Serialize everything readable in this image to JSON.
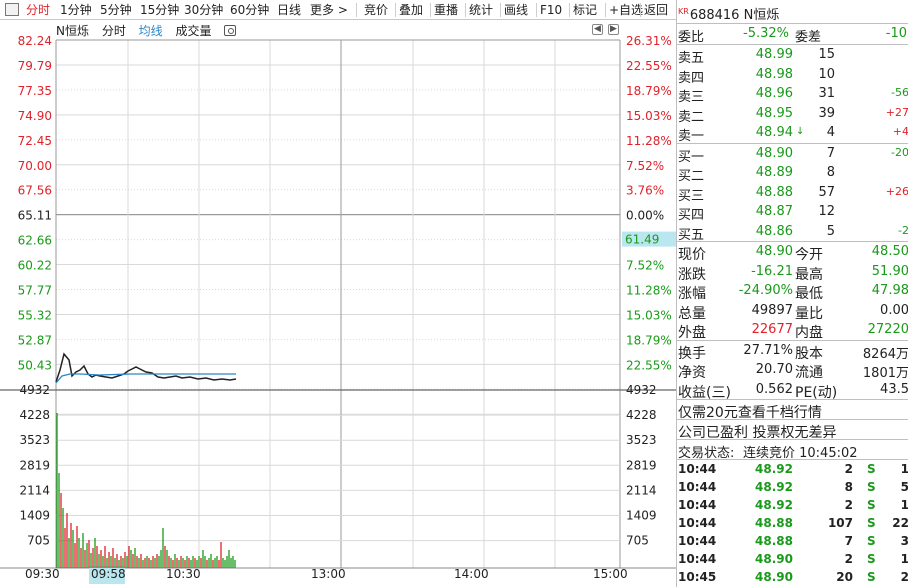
{
  "toolbar": {
    "tabs": [
      "分时",
      "1分钟",
      "5分钟",
      "15分钟",
      "30分钟",
      "60分钟",
      "日线",
      "更多 >"
    ],
    "actions": [
      "竞价",
      "叠加",
      "重播",
      "统计",
      "画线",
      "F10",
      "标记",
      "+自选",
      "返回"
    ]
  },
  "chart": {
    "header": {
      "name": "N恒烁",
      "mode": "分时",
      "avg": "均线",
      "vol": "成交量"
    },
    "price_labels": [
      "82.24",
      "79.79",
      "77.35",
      "74.90",
      "72.45",
      "70.00",
      "67.56",
      "65.11",
      "62.66",
      "60.22",
      "57.77",
      "55.32",
      "52.87",
      "50.43"
    ],
    "pct_labels": [
      "26.31%",
      "22.55%",
      "18.79%",
      "15.03%",
      "11.28%",
      "7.52%",
      "3.76%",
      "0.00%",
      "7.52%",
      "11.28%",
      "15.03%",
      "18.79%",
      "22.55%"
    ],
    "current_marker": "61.49",
    "vol_left_labels": [
      "4932",
      "4228",
      "3523",
      "2819",
      "2114",
      "1409",
      "705"
    ],
    "vol_right_labels": [
      "4932",
      "4228",
      "3523",
      "2819",
      "2114",
      "1409",
      "705"
    ],
    "time_labels": [
      "09:30",
      "09:58",
      "10:30",
      "13:00",
      "14:00",
      "15:00"
    ],
    "colors": {
      "up": "#e0222a",
      "down": "#1a9a1a",
      "price_line": "#222222",
      "avg_line": "#2a86c8",
      "grid": "#d9d9d9",
      "highlight": "#b9e6ef"
    }
  },
  "quote": {
    "market_tag": "KR",
    "code": "688416",
    "name": "N恒烁",
    "weibi_label": "委比",
    "weibi": "-5.32%",
    "weicha_label": "委差",
    "weicha": "-10",
    "asks": [
      {
        "label": "卖五",
        "price": "48.99",
        "vol": "15",
        "chg": ""
      },
      {
        "label": "卖四",
        "price": "48.98",
        "vol": "10",
        "chg": ""
      },
      {
        "label": "卖三",
        "price": "48.96",
        "vol": "31",
        "chg": "-56"
      },
      {
        "label": "卖二",
        "price": "48.95",
        "vol": "39",
        "chg": "+27"
      },
      {
        "label": "卖一",
        "price": "48.94",
        "vol": "4",
        "chg": "+4"
      }
    ],
    "bids": [
      {
        "label": "买一",
        "price": "48.90",
        "vol": "7",
        "chg": "-20"
      },
      {
        "label": "买二",
        "price": "48.89",
        "vol": "8",
        "chg": ""
      },
      {
        "label": "买三",
        "price": "48.88",
        "vol": "57",
        "chg": "+26"
      },
      {
        "label": "买四",
        "price": "48.87",
        "vol": "12",
        "chg": ""
      },
      {
        "label": "买五",
        "price": "48.86",
        "vol": "5",
        "chg": "-2"
      }
    ],
    "stats": [
      {
        "l1": "现价",
        "v1": "48.90",
        "c1": "g",
        "l2": "今开",
        "v2": "48.50",
        "c2": "g"
      },
      {
        "l1": "涨跌",
        "v1": "-16.21",
        "c1": "g",
        "l2": "最高",
        "v2": "51.90",
        "c2": "g"
      },
      {
        "l1": "涨幅",
        "v1": "-24.90%",
        "c1": "g",
        "l2": "最低",
        "v2": "47.98",
        "c2": "g"
      },
      {
        "l1": "总量",
        "v1": "49897",
        "c1": "",
        "l2": "量比",
        "v2": "0.00",
        "c2": ""
      },
      {
        "l1": "外盘",
        "v1": "22677",
        "c1": "r",
        "l2": "内盘",
        "v2": "27220",
        "c2": "g"
      }
    ],
    "stats2": [
      {
        "l1": "换手",
        "v1": "27.71%",
        "l2": "股本",
        "v2": "8264万"
      },
      {
        "l1": "净资",
        "v1": "20.70",
        "l2": "流通",
        "v2": "1801万"
      },
      {
        "l1": "收益(三)",
        "v1": "0.562",
        "l2": "PE(动)",
        "v2": "43.5"
      }
    ],
    "promo": "仅需20元查看千档行情",
    "notice": "公司已盈利 投票权无差异",
    "status_label": "交易状态:",
    "status": "连续竞价 10:45:02",
    "trades": [
      {
        "time": "10:44",
        "price": "48.92",
        "vol": "2",
        "side": "S",
        "n": "1"
      },
      {
        "time": "10:44",
        "price": "48.92",
        "vol": "8",
        "side": "S",
        "n": "5"
      },
      {
        "time": "10:44",
        "price": "48.92",
        "vol": "2",
        "side": "S",
        "n": "1"
      },
      {
        "time": "10:44",
        "price": "48.88",
        "vol": "107",
        "side": "S",
        "n": "22"
      },
      {
        "time": "10:44",
        "price": "48.88",
        "vol": "7",
        "side": "S",
        "n": "3"
      },
      {
        "time": "10:44",
        "price": "48.90",
        "vol": "2",
        "side": "S",
        "n": "1"
      },
      {
        "time": "10:45",
        "price": "48.90",
        "vol": "20",
        "side": "S",
        "n": "2"
      }
    ]
  }
}
